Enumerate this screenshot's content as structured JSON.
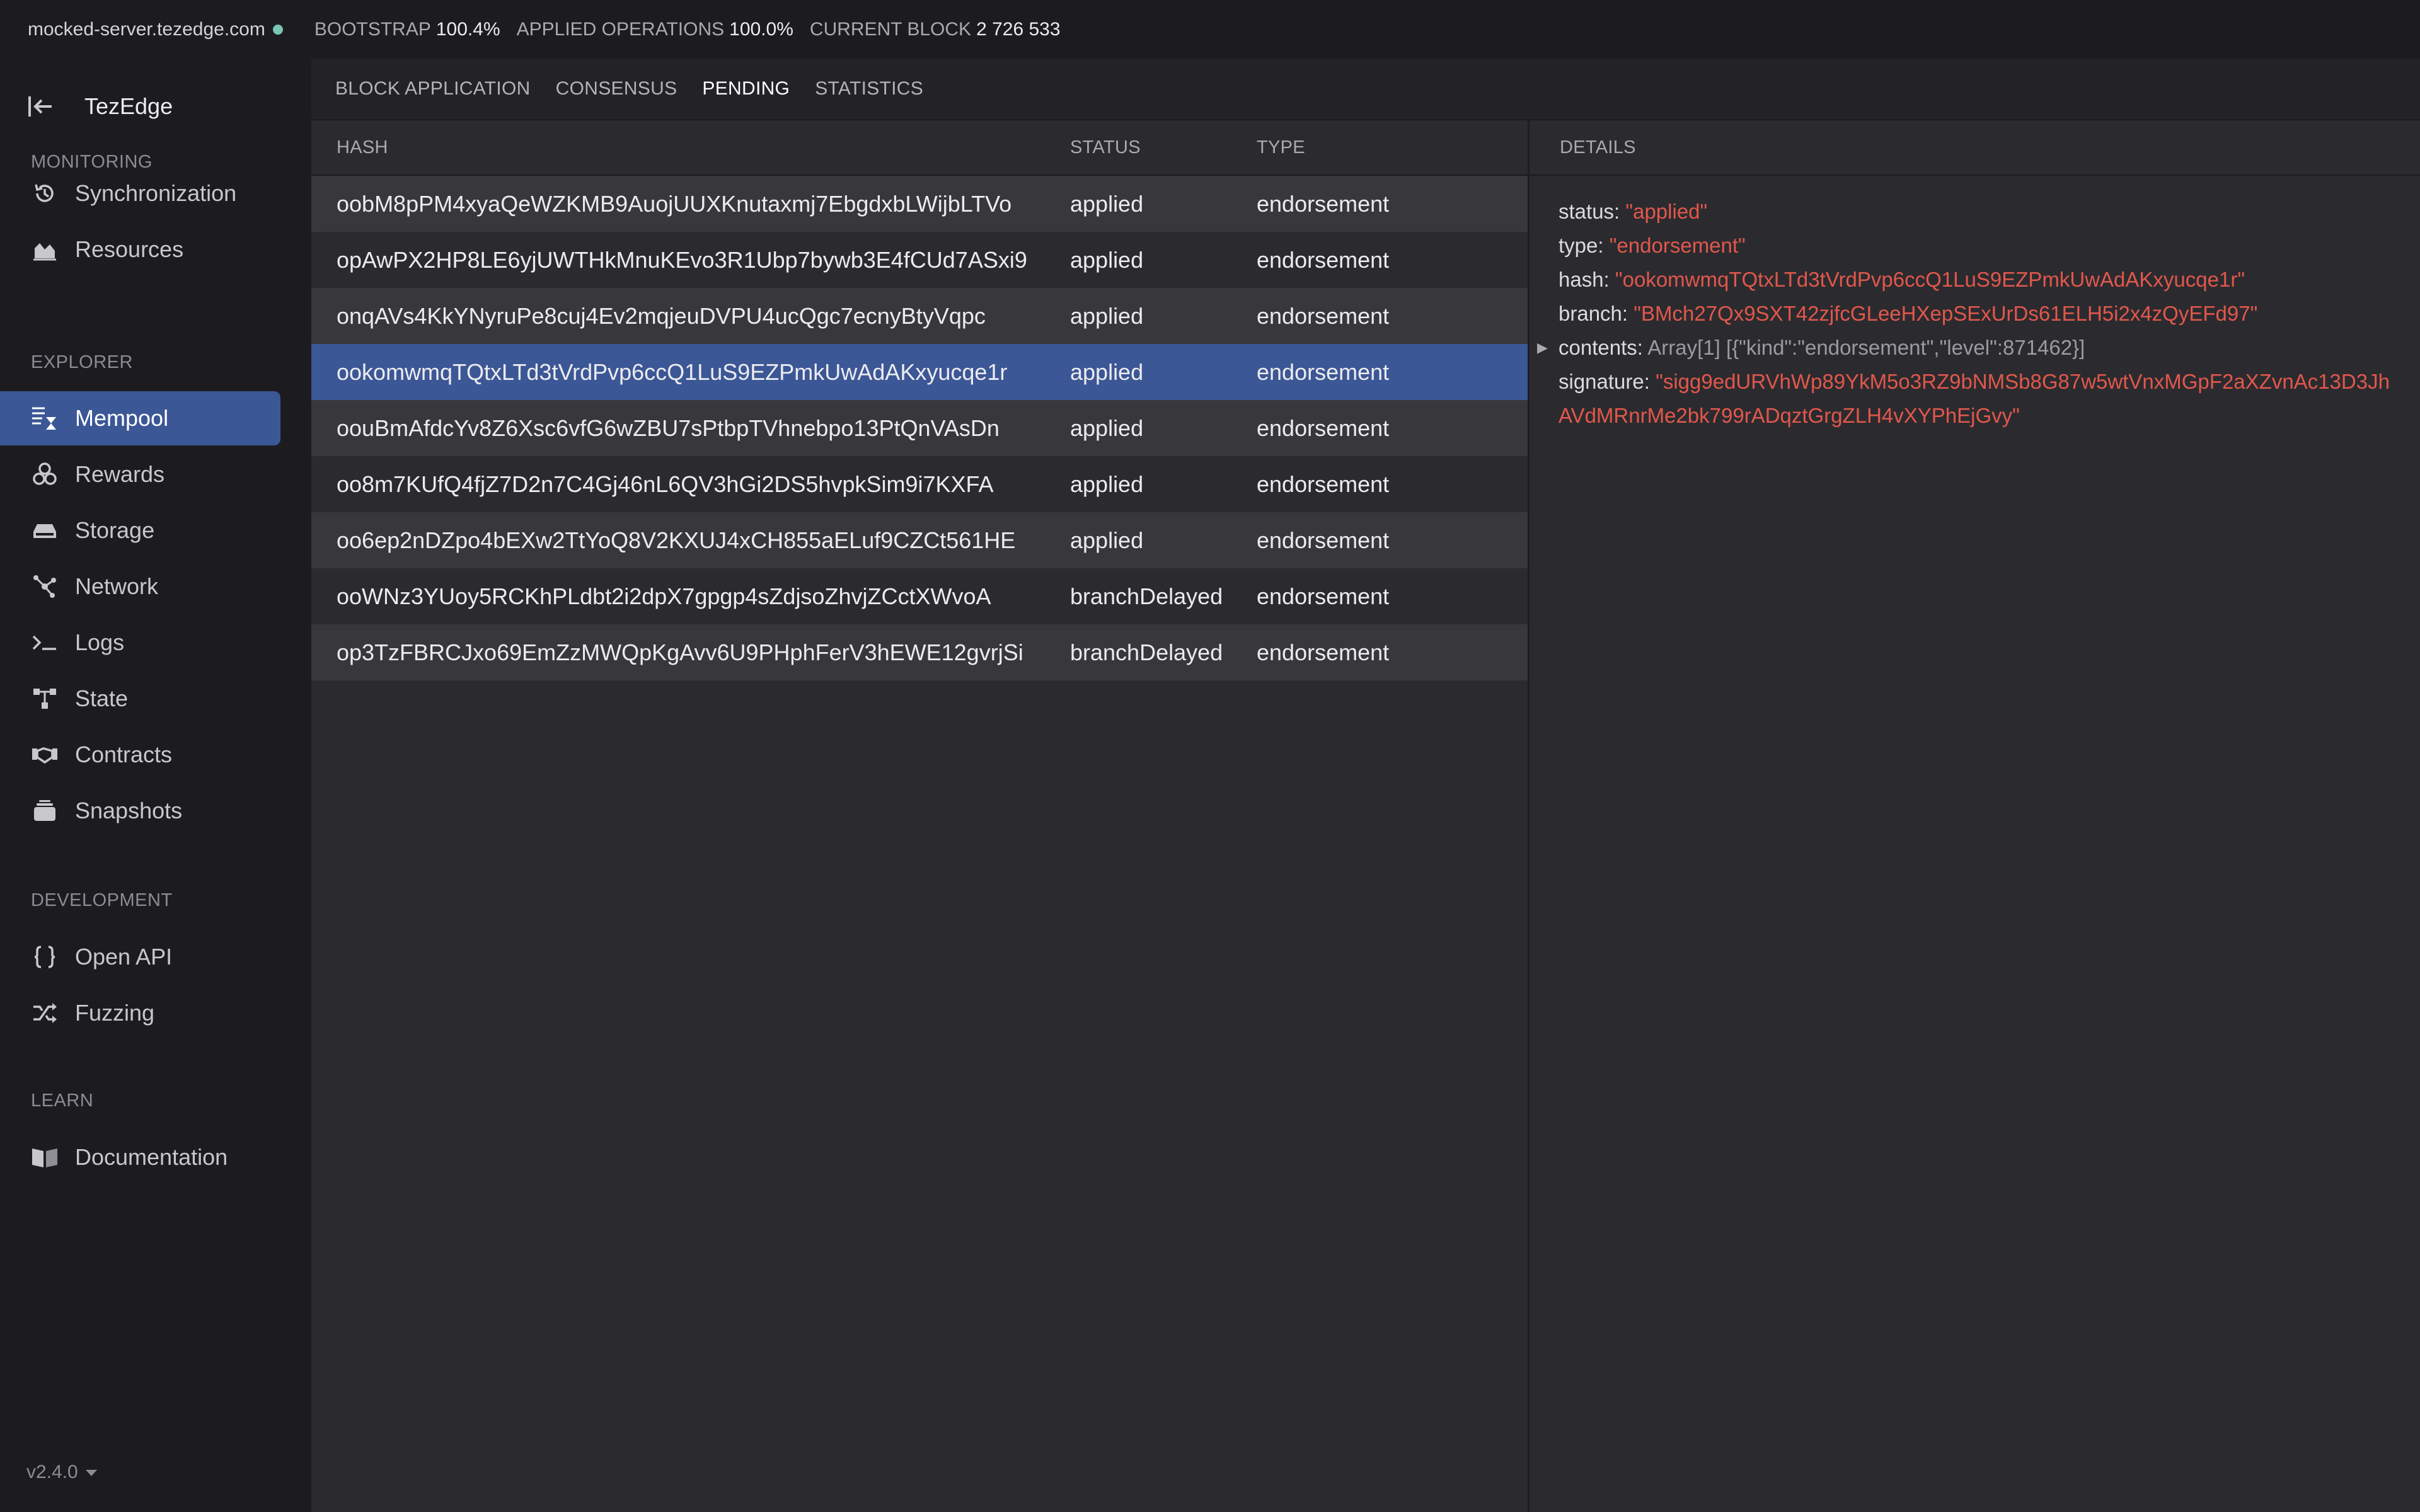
{
  "topbar": {
    "server": "mocked-server.tezedge.com",
    "bootstrap_label": "BOOTSTRAP",
    "bootstrap_value": "100.4%",
    "applied_label": "APPLIED OPERATIONS",
    "applied_value": "100.0%",
    "block_label": "CURRENT BLOCK",
    "block_value": "2 726 533",
    "status_color": "#7cc4b6"
  },
  "sidebar": {
    "app_name": "TezEdge",
    "sections": {
      "monitoring": "MONITORING",
      "explorer": "EXPLORER",
      "development": "DEVELOPMENT",
      "learn": "LEARN"
    },
    "items": [
      {
        "label": "Synchronization",
        "icon": "history-icon"
      },
      {
        "label": "Resources",
        "icon": "chart-area-icon"
      },
      {
        "label": "Mempool",
        "icon": "mempool-icon",
        "active": true
      },
      {
        "label": "Rewards",
        "icon": "coins-icon"
      },
      {
        "label": "Storage",
        "icon": "drive-icon"
      },
      {
        "label": "Network",
        "icon": "network-icon"
      },
      {
        "label": "Logs",
        "icon": "terminal-icon"
      },
      {
        "label": "State",
        "icon": "state-tree-icon"
      },
      {
        "label": "Contracts",
        "icon": "contract-icon"
      },
      {
        "label": "Snapshots",
        "icon": "snapshot-icon"
      },
      {
        "label": "Open API",
        "icon": "braces-icon"
      },
      {
        "label": "Fuzzing",
        "icon": "shuffle-icon"
      },
      {
        "label": "Documentation",
        "icon": "book-icon"
      }
    ],
    "version": "v2.4.0"
  },
  "tabs": [
    "BLOCK APPLICATION",
    "CONSENSUS",
    "PENDING",
    "STATISTICS"
  ],
  "active_tab": "PENDING",
  "table": {
    "headers": {
      "hash": "HASH",
      "status": "STATUS",
      "type": "TYPE"
    },
    "rows": [
      {
        "hash": "oobM8pPM4xyaQeWZKMB9AuojUUXKnutaxmj7EbgdxbLWijbLTVo",
        "status": "applied",
        "type": "endorsement"
      },
      {
        "hash": "opAwPX2HP8LE6yjUWTHkMnuKEvo3R1Ubp7bywb3E4fCUd7ASxi9",
        "status": "applied",
        "type": "endorsement"
      },
      {
        "hash": "onqAVs4KkYNyruPe8cuj4Ev2mqjeuDVPU4ucQgc7ecnyBtyVqpc",
        "status": "applied",
        "type": "endorsement"
      },
      {
        "hash": "ookomwmqTQtxLTd3tVrdPvp6ccQ1LuS9EZPmkUwAdAKxyucqe1r",
        "status": "applied",
        "type": "endorsement",
        "selected": true
      },
      {
        "hash": "oouBmAfdcYv8Z6Xsc6vfG6wZBU7sPtbpTVhnebpo13PtQnVAsDn",
        "status": "applied",
        "type": "endorsement"
      },
      {
        "hash": "oo8m7KUfQ4fjZ7D2n7C4Gj46nL6QV3hGi2DS5hvpkSim9i7KXFA",
        "status": "applied",
        "type": "endorsement"
      },
      {
        "hash": "oo6ep2nDZpo4bEXw2TtYoQ8V2KXUJ4xCH855aELuf9CZCt561HE",
        "status": "applied",
        "type": "endorsement"
      },
      {
        "hash": "ooWNz3YUoy5RCKhPLdbt2i2dpX7gpgp4sZdjsoZhvjZCctXWvoA",
        "status": "branchDelayed",
        "type": "endorsement"
      },
      {
        "hash": "op3TzFBRCJxo69EmZzMWQpKgAvv6U9PHphFerV3hEWE12gvrjSi",
        "status": "branchDelayed",
        "type": "endorsement"
      }
    ]
  },
  "details": {
    "header": "DETAILS",
    "status_key": "status:",
    "status_val": "\"applied\"",
    "type_key": "type:",
    "type_val": "\"endorsement\"",
    "hash_key": "hash:",
    "hash_val": "\"ookomwmqTQtxLTd3tVrdPvp6ccQ1LuS9EZPmkUwAdAKxyucqe1r\"",
    "branch_key": "branch:",
    "branch_val": "\"BMch27Qx9SXT42zjfcGLeeHXepSExUrDs61ELH5i2x4zQyEFd97\"",
    "contents_key": "contents:",
    "contents_val": "Array[1] [{\"kind\":\"endorsement\",\"level\":871462}]",
    "signature_key": "signature:",
    "signature_val": "\"sigg9edURVhWp89YkM5o3RZ9bNMSb8G87w5wtVnxMGpF2aXZvnAc13D3JhAVdMRnrMe2bk799rADqztGrgZLH4vXYPhEjGvy\""
  },
  "colors": {
    "accent": "#3c5796",
    "value_red": "#e2574c",
    "sidebar_bg": "#1c1c20",
    "content_bg": "#2b2b2f"
  }
}
